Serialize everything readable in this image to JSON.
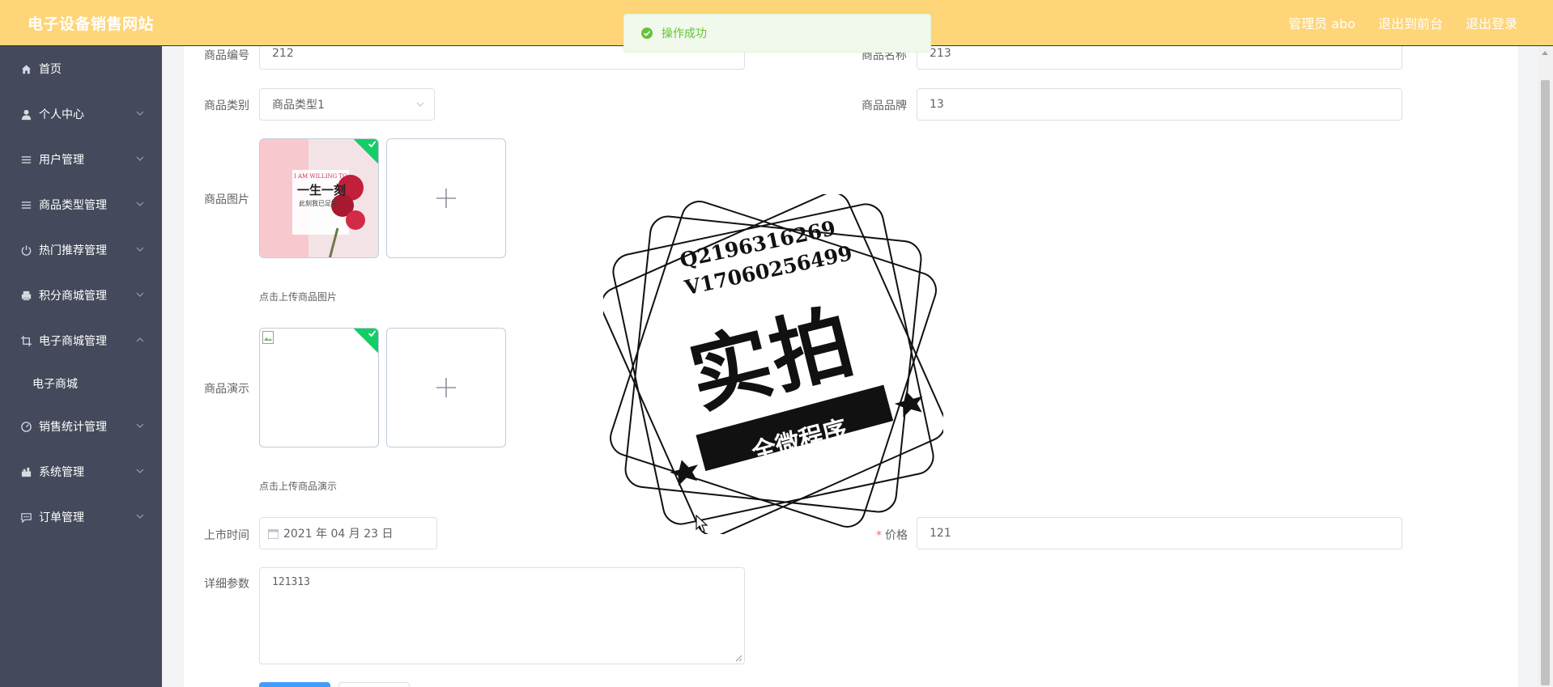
{
  "header": {
    "brand": "电子设备销售网站",
    "admin": "管理员 abo",
    "back_to_front": "退出到前台",
    "logout": "退出登录"
  },
  "toast": {
    "message": "操作成功"
  },
  "sidebar": {
    "items": [
      {
        "label": "首页",
        "icon": "home-icon"
      },
      {
        "label": "个人中心",
        "icon": "user-icon"
      },
      {
        "label": "用户管理",
        "icon": "menu-icon"
      },
      {
        "label": "商品类型管理",
        "icon": "menu-icon"
      },
      {
        "label": "热门推荐管理",
        "icon": "power-icon"
      },
      {
        "label": "积分商城管理",
        "icon": "printer-icon"
      },
      {
        "label": "电子商城管理",
        "icon": "crop-icon"
      },
      {
        "label": "销售统计管理",
        "icon": "gauge-icon"
      },
      {
        "label": "系统管理",
        "icon": "shop-icon"
      },
      {
        "label": "订单管理",
        "icon": "chat-icon"
      }
    ],
    "sub_item": "电子商城"
  },
  "form": {
    "product_no_label": "商品编号",
    "product_no_value": "212",
    "product_name_label": "商品名称",
    "product_name_value": "213",
    "category_label": "商品类别",
    "category_value": "商品类型1",
    "brand_label": "商品品牌",
    "brand_value": "13",
    "image_label": "商品图片",
    "image_hint": "点击上传商品图片",
    "demo_label": "商品演示",
    "demo_hint": "点击上传商品演示",
    "launch_label": "上市时间",
    "launch_value": "2021 年 04 月 23 日",
    "price_label": "价格",
    "price_value": "121",
    "params_label": "详细参数",
    "params_value": "121313"
  },
  "thumbnail": {
    "line1": "I AM WILLING TO",
    "line2": "一生一刻",
    "line3": "此刻我已足够"
  },
  "watermark": {
    "qq": "Q2196316269",
    "vx": "V17060256499",
    "big": "实拍",
    "banner": "全微程序"
  },
  "colors": {
    "header": "#fed578",
    "sidebar": "#444a5b",
    "success": "#13ce66",
    "primary": "#409eff"
  }
}
